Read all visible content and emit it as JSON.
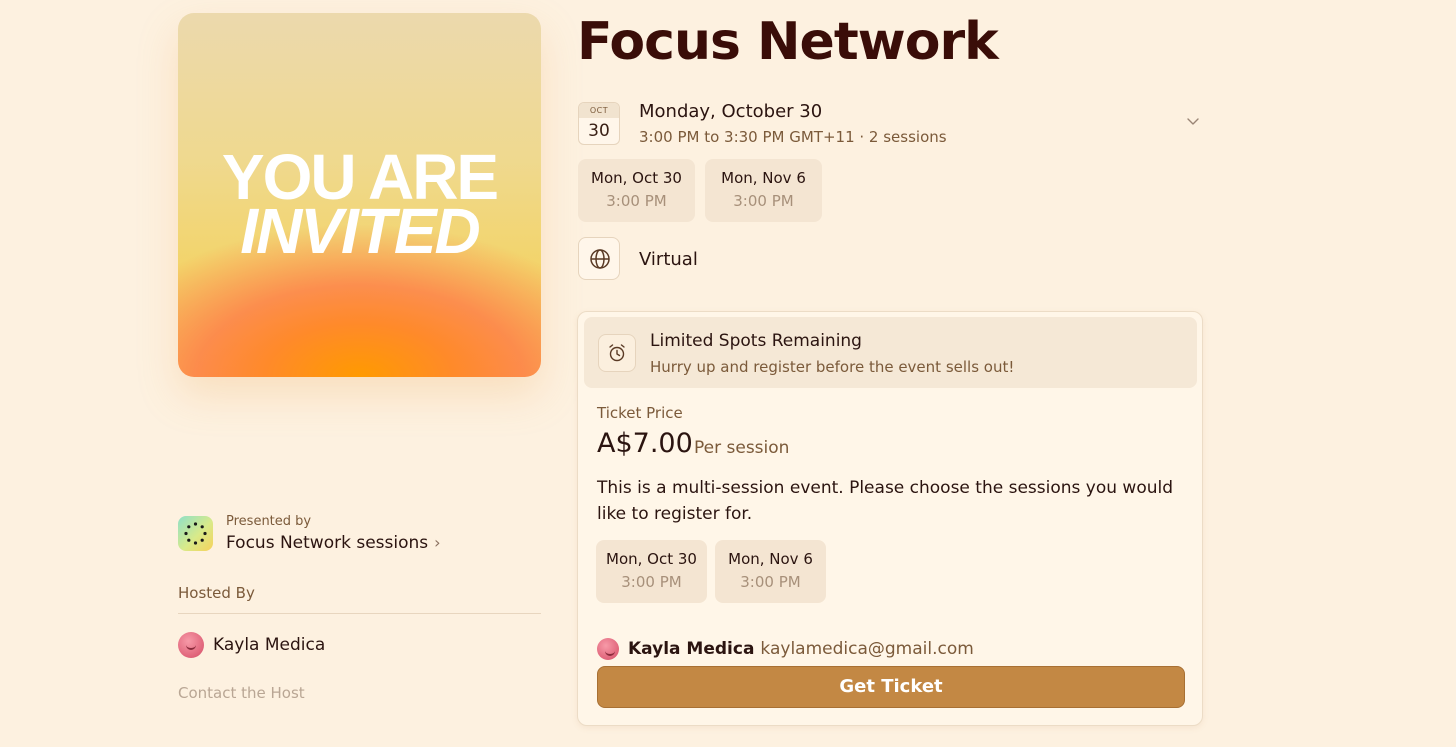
{
  "cover": {
    "line1": "YOU ARE",
    "line2": "INVITED"
  },
  "event": {
    "title": "Focus Network",
    "date_icon": {
      "month": "OCT",
      "day": "30"
    },
    "date_main": "Monday, October 30",
    "date_sub": "3:00 PM to 3:30 PM GMT+11 · 2 sessions",
    "sessions": [
      {
        "date": "Mon, Oct 30",
        "time": "3:00 PM"
      },
      {
        "date": "Mon, Nov 6",
        "time": "3:00 PM"
      }
    ],
    "location": "Virtual"
  },
  "presenter": {
    "small_label": "Presented by",
    "name": "Focus Network sessions",
    "chevron": "›"
  },
  "host": {
    "section_title": "Hosted By",
    "name": "Kayla Medica",
    "contact_label": "Contact the Host"
  },
  "registration": {
    "alert_title": "Limited Spots Remaining",
    "alert_sub": "Hurry up and register before the event sells out!",
    "price_label": "Ticket Price",
    "price": "A$7.00",
    "price_unit": "Per session",
    "description": "This is a multi-session event. Please choose the sessions you would like to register for.",
    "sessions": [
      {
        "date": "Mon, Oct 30",
        "time": "3:00 PM"
      },
      {
        "date": "Mon, Nov 6",
        "time": "3:00 PM"
      }
    ],
    "user_name": "Kayla Medica",
    "user_email": "kaylamedica@gmail.com",
    "button_label": "Get Ticket"
  },
  "colors": {
    "background": "#fdf1e0",
    "title": "#3a0d08",
    "accent_button": "#c38844"
  },
  "icons": [
    "calendar-date-icon",
    "chevron-down-icon",
    "globe-icon",
    "alarm-clock-icon",
    "avatar-icon",
    "presenter-logo-icon"
  ]
}
